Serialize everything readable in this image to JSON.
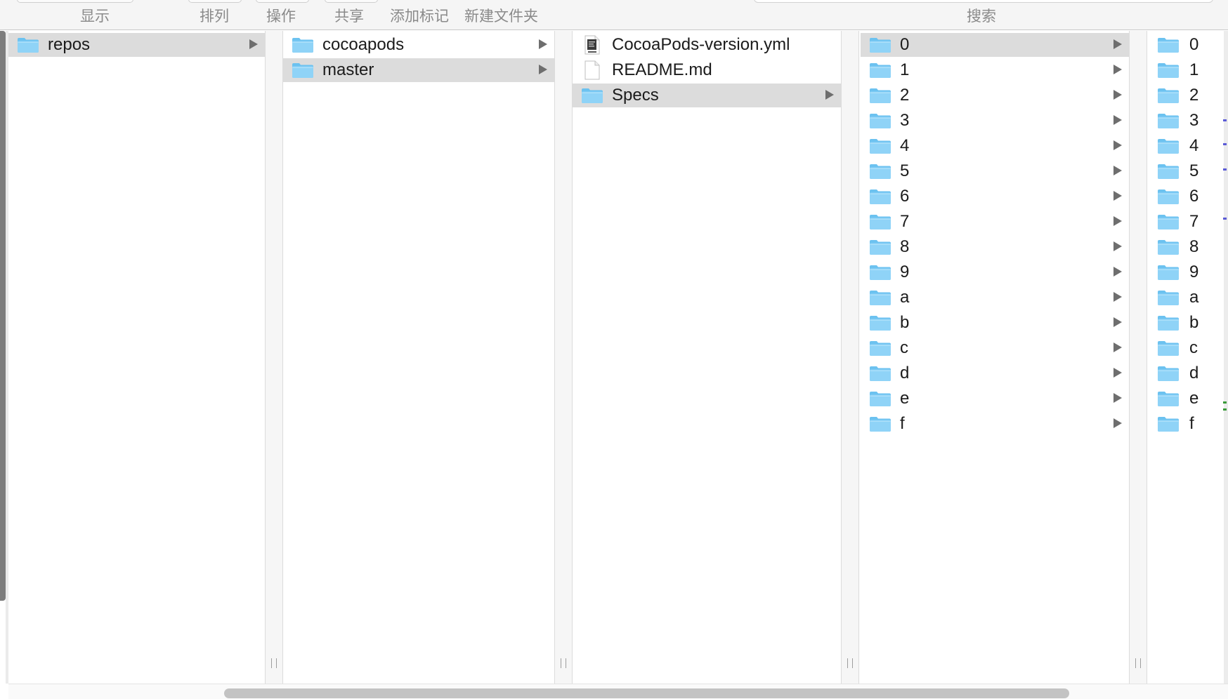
{
  "toolbar": {
    "view_label": "显示",
    "arrange_label": "排列",
    "action_label": "操作",
    "share_label": "共享",
    "tags_label": "添加标记",
    "new_folder_label": "新建文件夹",
    "search_label": "搜索"
  },
  "columns": [
    {
      "items": [
        {
          "name": "repos",
          "type": "folder",
          "selected": true,
          "has_children": true
        }
      ]
    },
    {
      "items": [
        {
          "name": "cocoapods",
          "type": "folder",
          "selected": false,
          "has_children": true
        },
        {
          "name": "master",
          "type": "folder",
          "selected": true,
          "has_children": true
        }
      ]
    },
    {
      "items": [
        {
          "name": "CocoaPods-version.yml",
          "type": "file-yaml",
          "selected": false,
          "has_children": false
        },
        {
          "name": "README.md",
          "type": "file",
          "selected": false,
          "has_children": false
        },
        {
          "name": "Specs",
          "type": "folder",
          "selected": true,
          "has_children": true
        }
      ]
    },
    {
      "items": [
        {
          "name": "0",
          "type": "folder",
          "selected": true,
          "has_children": true
        },
        {
          "name": "1",
          "type": "folder",
          "selected": false,
          "has_children": true
        },
        {
          "name": "2",
          "type": "folder",
          "selected": false,
          "has_children": true
        },
        {
          "name": "3",
          "type": "folder",
          "selected": false,
          "has_children": true
        },
        {
          "name": "4",
          "type": "folder",
          "selected": false,
          "has_children": true
        },
        {
          "name": "5",
          "type": "folder",
          "selected": false,
          "has_children": true
        },
        {
          "name": "6",
          "type": "folder",
          "selected": false,
          "has_children": true
        },
        {
          "name": "7",
          "type": "folder",
          "selected": false,
          "has_children": true
        },
        {
          "name": "8",
          "type": "folder",
          "selected": false,
          "has_children": true
        },
        {
          "name": "9",
          "type": "folder",
          "selected": false,
          "has_children": true
        },
        {
          "name": "a",
          "type": "folder",
          "selected": false,
          "has_children": true
        },
        {
          "name": "b",
          "type": "folder",
          "selected": false,
          "has_children": true
        },
        {
          "name": "c",
          "type": "folder",
          "selected": false,
          "has_children": true
        },
        {
          "name": "d",
          "type": "folder",
          "selected": false,
          "has_children": true
        },
        {
          "name": "e",
          "type": "folder",
          "selected": false,
          "has_children": true
        },
        {
          "name": "f",
          "type": "folder",
          "selected": false,
          "has_children": true
        }
      ]
    },
    {
      "items": [
        {
          "name": "0",
          "type": "folder",
          "selected": false,
          "has_children": false
        },
        {
          "name": "1",
          "type": "folder",
          "selected": false,
          "has_children": false
        },
        {
          "name": "2",
          "type": "folder",
          "selected": false,
          "has_children": false
        },
        {
          "name": "3",
          "type": "folder",
          "selected": false,
          "has_children": false
        },
        {
          "name": "4",
          "type": "folder",
          "selected": false,
          "has_children": false
        },
        {
          "name": "5",
          "type": "folder",
          "selected": false,
          "has_children": false
        },
        {
          "name": "6",
          "type": "folder",
          "selected": false,
          "has_children": false
        },
        {
          "name": "7",
          "type": "folder",
          "selected": false,
          "has_children": false
        },
        {
          "name": "8",
          "type": "folder",
          "selected": false,
          "has_children": false
        },
        {
          "name": "9",
          "type": "folder",
          "selected": false,
          "has_children": false
        },
        {
          "name": "a",
          "type": "folder",
          "selected": false,
          "has_children": false
        },
        {
          "name": "b",
          "type": "folder",
          "selected": false,
          "has_children": false
        },
        {
          "name": "c",
          "type": "folder",
          "selected": false,
          "has_children": false
        },
        {
          "name": "d",
          "type": "folder",
          "selected": false,
          "has_children": false
        },
        {
          "name": "e",
          "type": "folder",
          "selected": false,
          "has_children": false
        },
        {
          "name": "f",
          "type": "folder",
          "selected": false,
          "has_children": false
        }
      ]
    }
  ],
  "icons": {
    "folder": "folder-icon",
    "file": "document-icon",
    "file_yaml": "yaml-file-icon",
    "disclosure": "disclosure-arrow-icon",
    "column_resize": "column-resize-handle-icon"
  },
  "colors": {
    "selection": "#dcdcdc",
    "folder_fill": "#8fd3f7",
    "folder_tab": "#6cc2f0",
    "toolbar_text": "#8a8a8a",
    "item_text": "#1b1b1b"
  }
}
